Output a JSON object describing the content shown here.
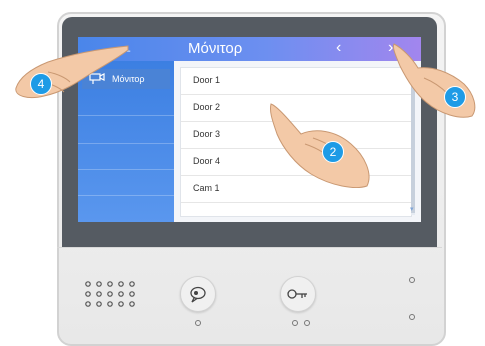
{
  "screen": {
    "title": "Μόνιτορ",
    "back_icon": "arrow-left-icon",
    "prev_icon": "chevron-left-icon",
    "next_icon": "chevron-right-icon"
  },
  "sidebar": {
    "items": [
      {
        "label": "Μόνιτορ",
        "icon": "camera-icon"
      }
    ]
  },
  "list": {
    "items": [
      "Door 1",
      "Door 2",
      "Door 3",
      "Door 4",
      "Cam 1"
    ]
  },
  "device": {
    "buttons": [
      {
        "icon": "talk-icon"
      },
      {
        "icon": "key-icon"
      }
    ]
  },
  "callouts": [
    "4",
    "2",
    "3"
  ],
  "colors": {
    "topbar_start": "#4a86ea",
    "topbar_end": "#a286ee",
    "sidebar": "#3c7fe2",
    "badge": "#1e9be6"
  }
}
